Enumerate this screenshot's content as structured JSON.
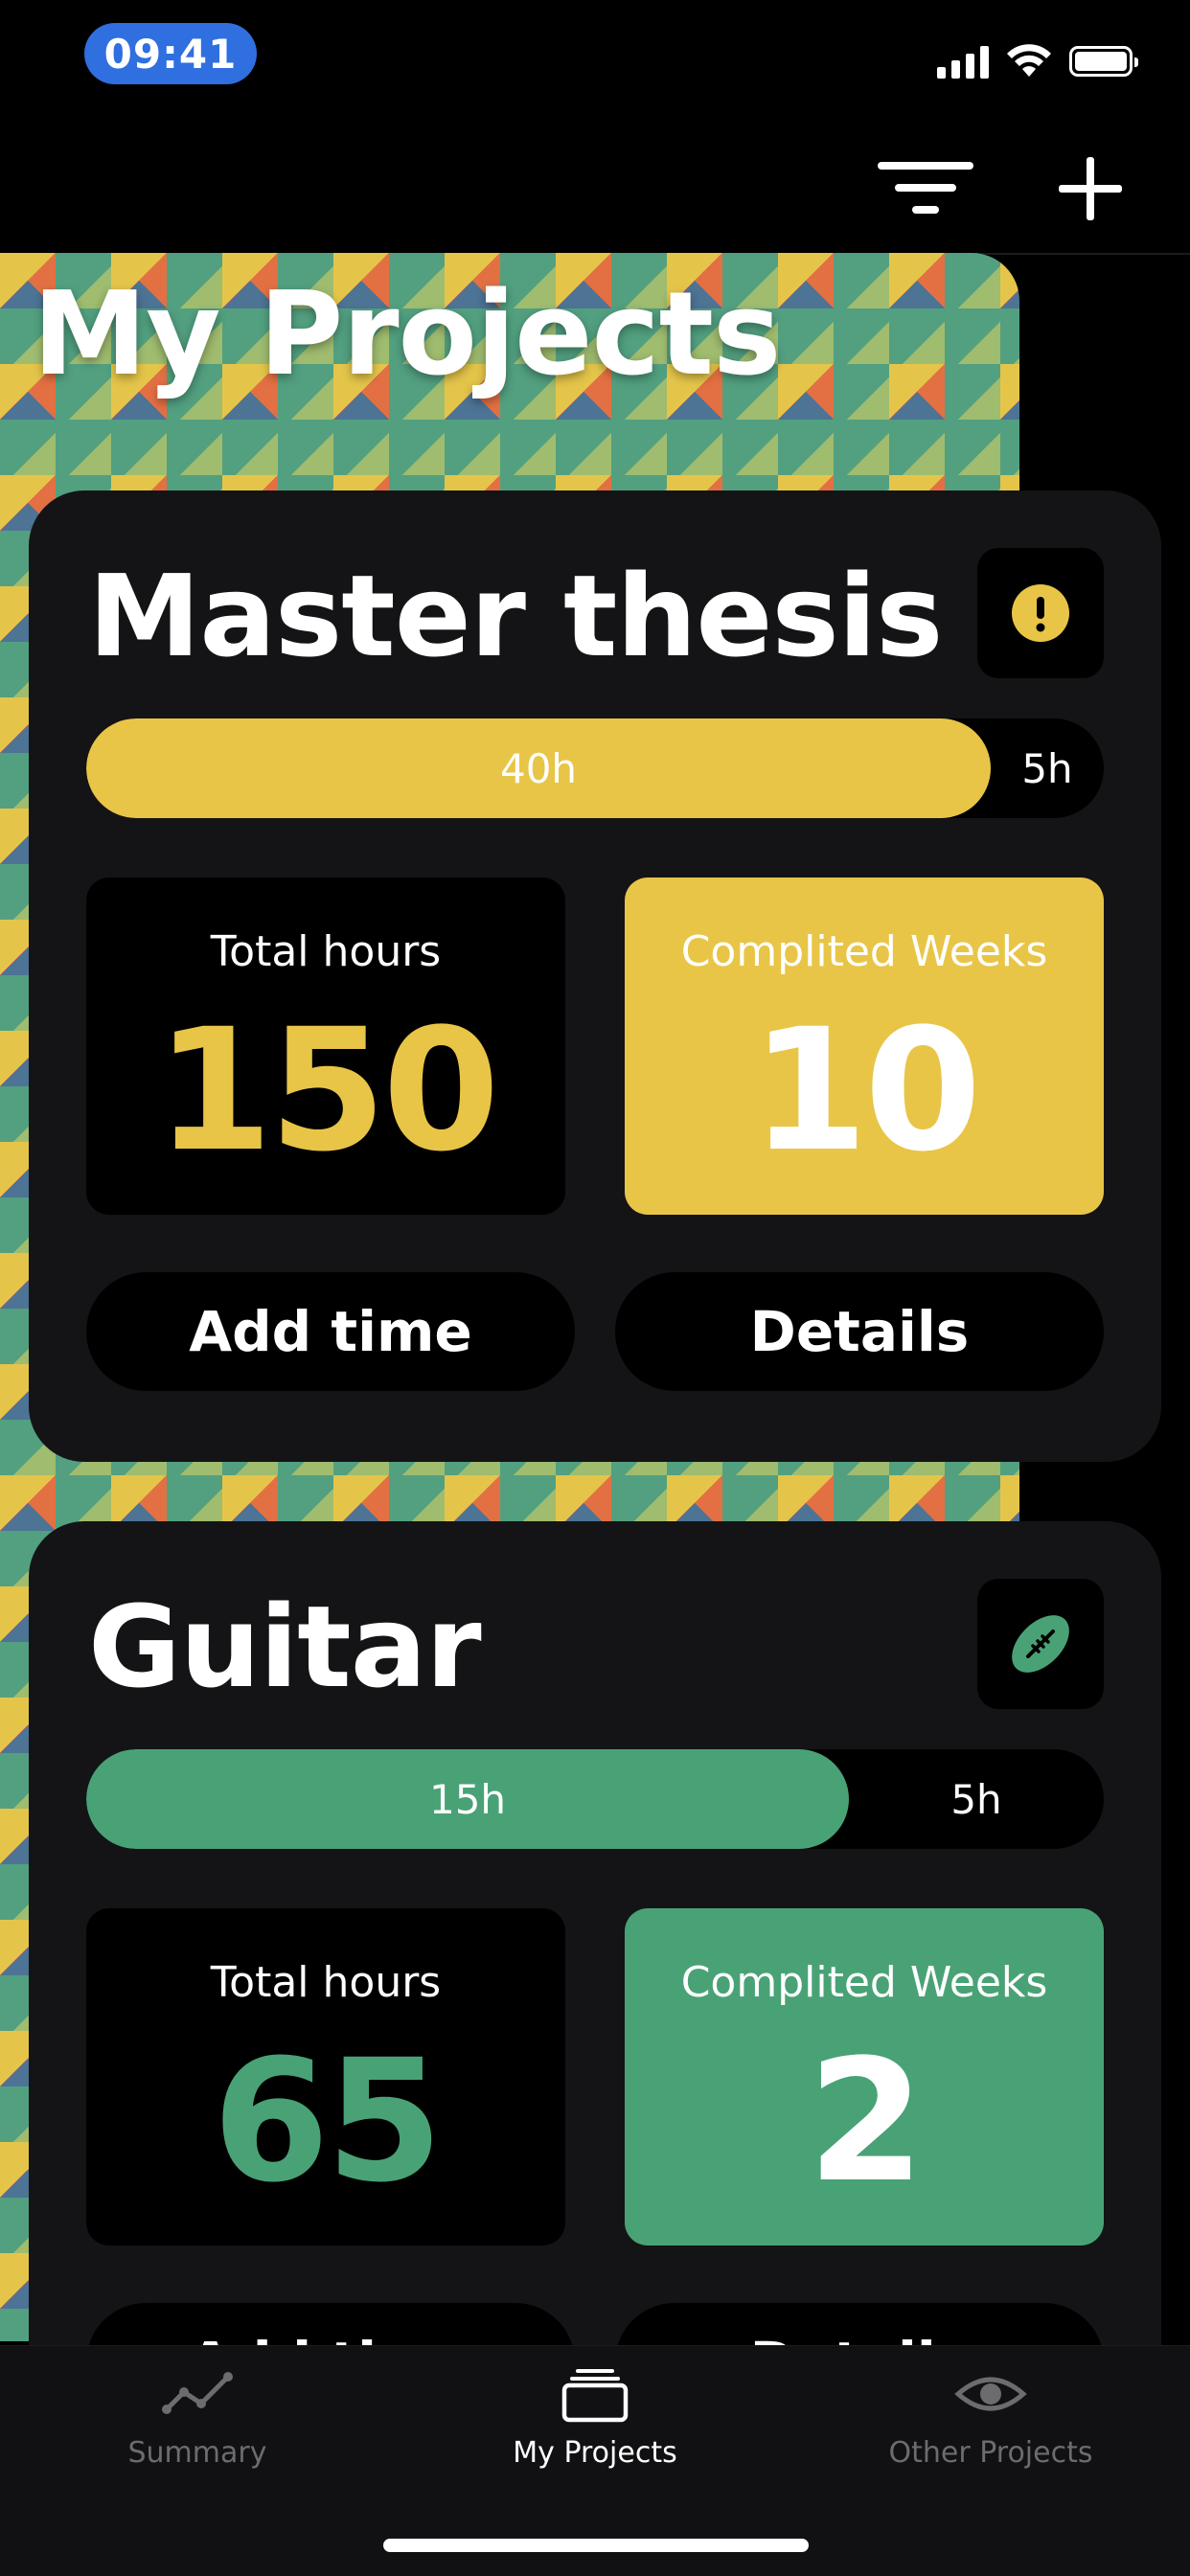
{
  "status_bar": {
    "time": "09:41"
  },
  "page": {
    "title": "My Projects"
  },
  "colors": {
    "yellow": "#e8c547",
    "green": "#49a276",
    "card": "#141416"
  },
  "projects": [
    {
      "name": "Master thesis",
      "icon": "exclamation-icon",
      "progress_fill_label": "40h",
      "progress_rest_label": "5h",
      "progress_fraction": 0.889,
      "total_hours_label": "Total hours",
      "total_hours": "150",
      "weeks_label": "Complited Weeks",
      "weeks": "10",
      "add_time_label": "Add time",
      "details_label": "Details"
    },
    {
      "name": "Guitar",
      "icon": "football-icon",
      "progress_fill_label": "15h",
      "progress_rest_label": "5h",
      "progress_fraction": 0.75,
      "total_hours_label": "Total hours",
      "total_hours": "65",
      "weeks_label": "Complited Weeks",
      "weeks": "2",
      "add_time_label": "Add time",
      "details_label": "Details"
    }
  ],
  "tabs": [
    {
      "label": "Summary",
      "icon": "chart-line-icon",
      "active": false
    },
    {
      "label": "My Projects",
      "icon": "folder-stack-icon",
      "active": true
    },
    {
      "label": "Other Projects",
      "icon": "eye-icon",
      "active": false
    }
  ]
}
